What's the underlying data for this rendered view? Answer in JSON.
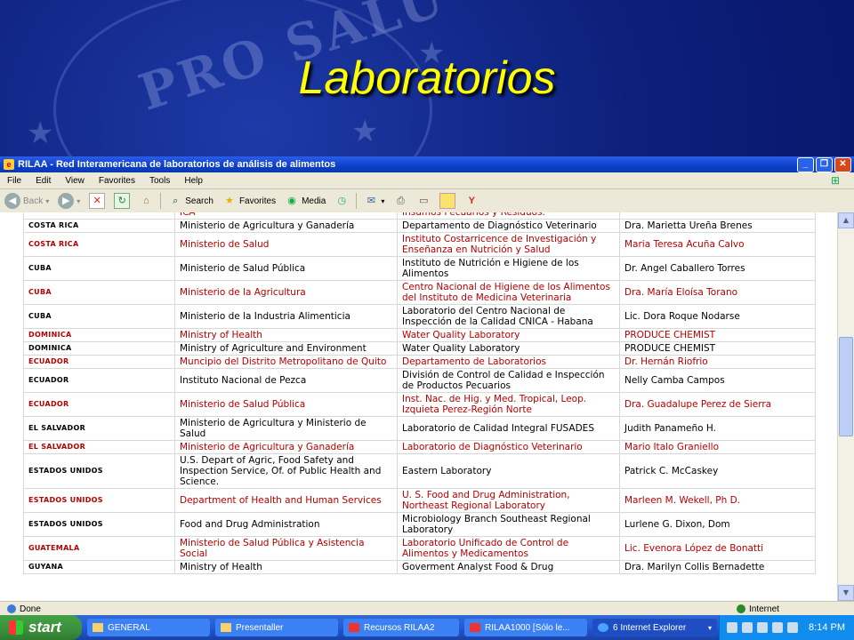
{
  "slide": {
    "title": "Laboratorios",
    "watermark": "PRO SALU"
  },
  "window": {
    "title": "RILAA - Red Interamericana de laboratorios de análisis de alimentos",
    "menu": [
      "File",
      "Edit",
      "View",
      "Favorites",
      "Tools",
      "Help"
    ],
    "toolbar": {
      "back": "Back",
      "search": "Search",
      "favorites": "Favorites",
      "media": "Media"
    }
  },
  "table": {
    "rows": [
      {
        "country": "",
        "ministry": "ICA",
        "lab": "Insumos Pecuarios y Residuos.",
        "contact": "",
        "red": true
      },
      {
        "country": "COSTA RICA",
        "ministry": "Ministerio de Agricultura y Ganadería",
        "lab": "Departamento de Diagnóstico Veterinario",
        "contact": "Dra. Marietta Ureña Brenes",
        "red": false
      },
      {
        "country": "COSTA RICA",
        "ministry": "Ministerio de Salud",
        "lab": "Instituto Costarricence de Investigación y Enseñanza en Nutrición y Salud",
        "contact": "Maria Teresa Acuña Calvo",
        "red": true
      },
      {
        "country": "CUBA",
        "ministry": "Ministerio de Salud Pública",
        "lab": "Instituto de Nutrición e Higiene de los Alimentos",
        "contact": "Dr. Angel Caballero Torres",
        "red": false
      },
      {
        "country": "CUBA",
        "ministry": "Ministerio de la Agricultura",
        "lab": "Centro Nacional de Higiene de los Alimentos del Instituto de Medicina Veterinaria",
        "contact": "Dra. María Eloísa Torano",
        "red": true
      },
      {
        "country": "CUBA",
        "ministry": "Ministerio de la Industria Alimenticia",
        "lab": "Laboratorio del Centro Nacional de Inspección de la Calidad CNICA - Habana",
        "contact": "Lic. Dora Roque Nodarse",
        "red": false
      },
      {
        "country": "DOMINICA",
        "ministry": "Ministry of Health",
        "lab": "Water Quality Laboratory",
        "contact": "PRODUCE CHEMIST",
        "red": true
      },
      {
        "country": "DOMINICA",
        "ministry": "Ministry of Agriculture and Environment",
        "lab": "Water Quality Laboratory",
        "contact": "PRODUCE CHEMIST",
        "red": false
      },
      {
        "country": "ECUADOR",
        "ministry": "Muncipio del Distrito Metropolitano de Quito",
        "lab": "Departamento de Laboratorios",
        "contact": "Dr. Hernán Riofrio",
        "red": true
      },
      {
        "country": "ECUADOR",
        "ministry": "Instituto Nacional de Pezca",
        "lab": "División de Control de Calidad e Inspección de Productos Pecuarios",
        "contact": "Nelly Camba Campos",
        "red": false
      },
      {
        "country": "ECUADOR",
        "ministry": "Ministerio de Salud Pública",
        "lab": "Inst. Nac. de Hig. y Med. Tropical, Leop. Izquieta Perez-Región Norte",
        "contact": "Dra. Guadalupe Perez de Sierra",
        "red": true
      },
      {
        "country": "EL SALVADOR",
        "ministry": "Ministerio de Agricultura y Ministerio de Salud",
        "lab": "Laboratorio de Calidad Integral FUSADES",
        "contact": "Judith Panameño H.",
        "red": false
      },
      {
        "country": "EL SALVADOR",
        "ministry": "Ministerio de Agricultura y Ganadería",
        "lab": "Laboratorio de Diagnóstico Veterinario",
        "contact": "Mario Italo Graniello",
        "red": true
      },
      {
        "country": "ESTADOS UNIDOS",
        "ministry": "U.S. Depart of Agric, Food Safety and Inspection Service, Of. of Public Health and Science.",
        "lab": "Eastern Laboratory",
        "contact": "Patrick C. McCaskey",
        "red": false
      },
      {
        "country": "ESTADOS UNIDOS",
        "ministry": "Department of Health and Human Services",
        "lab": "U. S. Food and Drug Administration, Northeast Regional Laboratory",
        "contact": "Marleen M. Wekell, Ph D.",
        "red": true
      },
      {
        "country": "ESTADOS UNIDOS",
        "ministry": "Food and Drug Administration",
        "lab": "Microbiology Branch Southeast Regional Laboratory",
        "contact": "Lurlene G. Dixon, Dom",
        "red": false
      },
      {
        "country": "GUATEMALA",
        "ministry": "Ministerio de Salud Pública y Asistencia Social",
        "lab": "Laboratorio Unificado de Control de Alimentos y Medicamentos",
        "contact": "Lic. Evenora López de Bonatti",
        "red": true
      },
      {
        "country": "GUYANA",
        "ministry": "Ministry of Health",
        "lab": "Goverment Analyst Food & Drug",
        "contact": "Dra. Marilyn Collis Bernadette",
        "red": false
      }
    ]
  },
  "status": {
    "left": "Done",
    "zone": "Internet"
  },
  "taskbar": {
    "start": "start",
    "tasks": [
      "GENERAL",
      "Presentaller",
      "Recursos RILAA2",
      "RILAA1000 [Sólo le...",
      "6 Internet Explorer"
    ],
    "clock": "8:14 PM"
  }
}
